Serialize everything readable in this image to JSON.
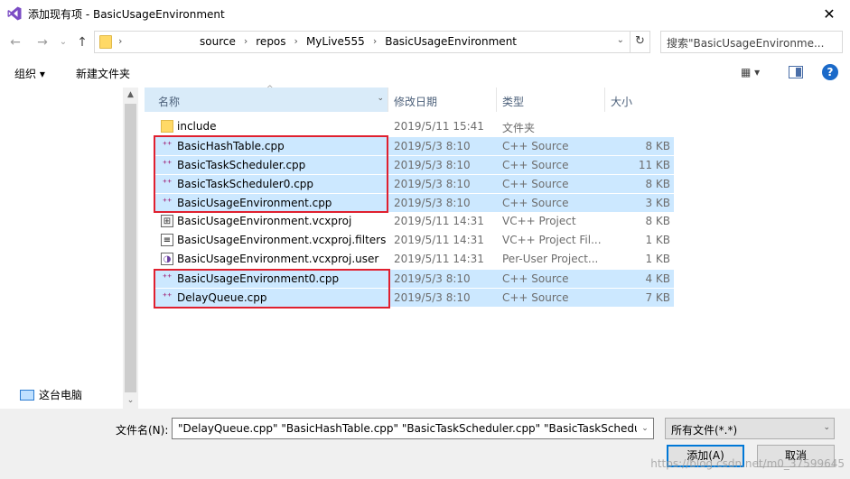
{
  "window": {
    "title": "添加现有项 - BasicUsageEnvironment",
    "close_glyph": "✕"
  },
  "nav": {
    "back_glyph": "←",
    "forward_glyph": "→",
    "recent_glyph": "⌄",
    "up_glyph": "↑",
    "root_chevron": "›",
    "breadcrumbs": [
      "source",
      "repos",
      "MyLive555",
      "BasicUsageEnvironment"
    ],
    "separator": "›",
    "dropdown_glyph": "⌄",
    "refresh_glyph": "↻",
    "search_placeholder": "搜索\"BasicUsageEnvironme..."
  },
  "toolbar": {
    "organize_label": "组织 ▾",
    "new_folder_label": "新建文件夹",
    "view_glyph": "▦ ▾",
    "help_glyph": "?"
  },
  "navpane": {
    "this_pc_label": "这台电脑",
    "scroll_up": "▲",
    "scroll_down": "⌄"
  },
  "columns": {
    "name": "名称",
    "date": "修改日期",
    "type": "类型",
    "size": "大小",
    "sort_glyph": "^",
    "drop_glyph": "⌄"
  },
  "files": [
    {
      "name": "include",
      "date": "2019/5/11 15:41",
      "type": "文件夹",
      "size": "",
      "icon": "folder-icon",
      "selected": false
    },
    {
      "name": "BasicHashTable.cpp",
      "date": "2019/5/3 8:10",
      "type": "C++ Source",
      "size": "8 KB",
      "icon": "cpp-file-icon",
      "selected": true
    },
    {
      "name": "BasicTaskScheduler.cpp",
      "date": "2019/5/3 8:10",
      "type": "C++ Source",
      "size": "11 KB",
      "icon": "cpp-file-icon",
      "selected": true
    },
    {
      "name": "BasicTaskScheduler0.cpp",
      "date": "2019/5/3 8:10",
      "type": "C++ Source",
      "size": "8 KB",
      "icon": "cpp-file-icon",
      "selected": true
    },
    {
      "name": "BasicUsageEnvironment.cpp",
      "date": "2019/5/3 8:10",
      "type": "C++ Source",
      "size": "3 KB",
      "icon": "cpp-file-icon",
      "selected": true
    },
    {
      "name": "BasicUsageEnvironment.vcxproj",
      "date": "2019/5/11 14:31",
      "type": "VC++ Project",
      "size": "8 KB",
      "icon": "vcxproj-icon",
      "selected": false
    },
    {
      "name": "BasicUsageEnvironment.vcxproj.filters",
      "date": "2019/5/11 14:31",
      "type": "VC++ Project Fil...",
      "size": "1 KB",
      "icon": "filters-file-icon",
      "selected": false
    },
    {
      "name": "BasicUsageEnvironment.vcxproj.user",
      "date": "2019/5/11 14:31",
      "type": "Per-User Project...",
      "size": "1 KB",
      "icon": "user-file-icon",
      "selected": false
    },
    {
      "name": "BasicUsageEnvironment0.cpp",
      "date": "2019/5/3 8:10",
      "type": "C++ Source",
      "size": "4 KB",
      "icon": "cpp-file-icon",
      "selected": true
    },
    {
      "name": "DelayQueue.cpp",
      "date": "2019/5/3 8:10",
      "type": "C++ Source",
      "size": "7 KB",
      "icon": "cpp-file-icon",
      "selected": true
    }
  ],
  "bottom": {
    "filename_label": "文件名(N):",
    "filename_value": "\"DelayQueue.cpp\" \"BasicHashTable.cpp\" \"BasicTaskScheduler.cpp\" \"BasicTaskScheduler",
    "filetype_value": "所有文件(*.*)",
    "add_label": "添加(A)",
    "cancel_label": "取消",
    "watermark": "https://blog.csdn.net/m0_37599645"
  },
  "colors": {
    "selection": "#cce8ff",
    "annotation_red": "#e0202f",
    "accent": "#0078d7"
  }
}
